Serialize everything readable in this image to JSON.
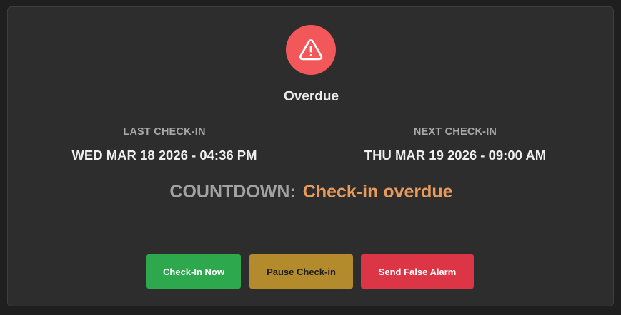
{
  "status": {
    "icon": "warning-triangle-icon",
    "label": "Overdue",
    "color": "#f2575a"
  },
  "last_checkin": {
    "label": "LAST CHECK-IN",
    "value": "WED MAR 18 2026 - 04:36 PM"
  },
  "next_checkin": {
    "label": "NEXT CHECK-IN",
    "value": "THU MAR 19 2026 - 09:00 AM"
  },
  "countdown": {
    "label": "COUNTDOWN:",
    "value": "Check-in overdue",
    "value_color": "#e89a5b"
  },
  "actions": {
    "checkin_now": {
      "label": "Check-In Now",
      "bg": "#2ea84c",
      "fg": "#ffffff"
    },
    "pause_checkin": {
      "label": "Pause Check-in",
      "bg": "#b38a2c",
      "fg": "#1e1e1e"
    },
    "send_false_alarm": {
      "label": "Send False Alarm",
      "bg": "#dc3545",
      "fg": "#ffffff"
    }
  }
}
